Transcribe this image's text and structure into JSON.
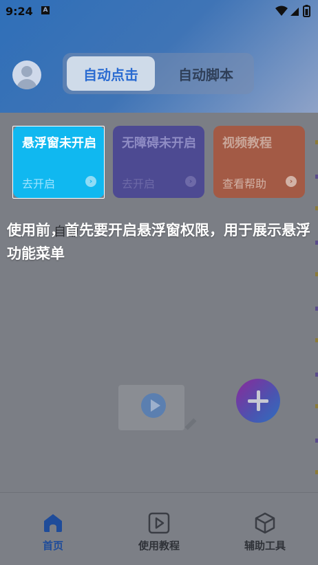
{
  "statusbar": {
    "time": "9:24",
    "notif_icon": "A"
  },
  "header": {
    "tabs": [
      {
        "label": "自动点击",
        "active": true
      },
      {
        "label": "自动脚本",
        "active": false
      }
    ]
  },
  "cards": [
    {
      "title": "悬浮窗未开启",
      "action": "去开启",
      "color": "#10b8f0"
    },
    {
      "title": "无障碍未开启",
      "action": "去开启",
      "color": "#4d4a92"
    },
    {
      "title": "视频教程",
      "action": "查看帮助",
      "color": "#a35a45"
    }
  ],
  "guide": {
    "text": "使用前，首先要开启悬浮窗权限，用于展示悬浮功能菜单",
    "hidden_label": "自动"
  },
  "fab": {
    "icon": "plus-icon"
  },
  "bottomnav": {
    "items": [
      {
        "label": "首页",
        "icon": "home-icon",
        "active": true
      },
      {
        "label": "使用教程",
        "icon": "play-icon",
        "active": false
      },
      {
        "label": "辅助工具",
        "icon": "box-icon",
        "active": false
      }
    ]
  }
}
